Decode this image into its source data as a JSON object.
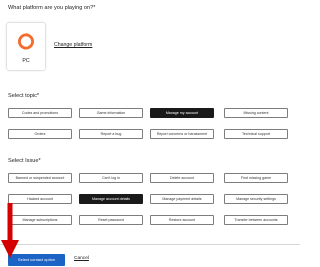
{
  "platform_section": {
    "heading": "What platform are you playing on?*",
    "selected_platform": {
      "label": "PC",
      "icon": "origin-logo-icon"
    },
    "change_link": "Change platform"
  },
  "topic_section": {
    "heading": "Select topic*",
    "options": [
      {
        "label": "Codes and promotions",
        "selected": false
      },
      {
        "label": "Game information",
        "selected": false
      },
      {
        "label": "Manage my account",
        "selected": true
      },
      {
        "label": "Missing content",
        "selected": false
      },
      {
        "label": "Orders",
        "selected": false
      },
      {
        "label": "Report a bug",
        "selected": false
      },
      {
        "label": "Report concerns or harassment",
        "selected": false
      },
      {
        "label": "Technical support",
        "selected": false
      }
    ]
  },
  "issue_section": {
    "heading": "Select Issue*",
    "options": [
      {
        "label": "Banned or suspended account",
        "selected": false
      },
      {
        "label": "Can't log in",
        "selected": false
      },
      {
        "label": "Delete account",
        "selected": false
      },
      {
        "label": "Find missing game",
        "selected": false
      },
      {
        "label": "Hacked account",
        "selected": false
      },
      {
        "label": "Manage account details",
        "selected": true
      },
      {
        "label": "Manage payment details",
        "selected": false
      },
      {
        "label": "Manage security settings",
        "selected": false
      },
      {
        "label": "Manage subscriptions",
        "selected": false
      },
      {
        "label": "Reset password",
        "selected": false
      },
      {
        "label": "Restore account",
        "selected": false
      },
      {
        "label": "Transfer between accounts",
        "selected": false
      }
    ]
  },
  "footer": {
    "primary_button": "Select contact option",
    "cancel_link": "Cancel"
  },
  "colors": {
    "primary": "#1c63c6",
    "selected_chip": "#1a1a1a",
    "arrow": "#d40000",
    "origin_orange": "#f56c2d"
  }
}
